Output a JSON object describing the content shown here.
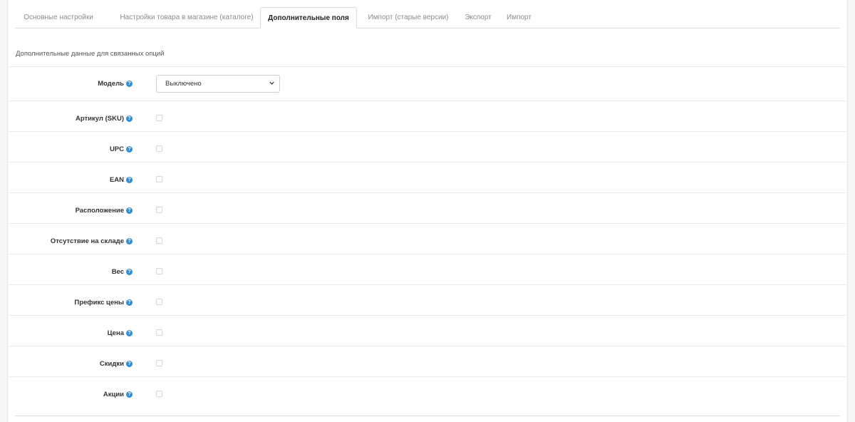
{
  "tabs": [
    {
      "label": "Основные настройки",
      "active": false
    },
    {
      "label": "Настройки товара в магазине (каталоге)",
      "active": false
    },
    {
      "label": "Дополнительные поля",
      "active": true
    },
    {
      "label": "Импорт (старые версии)",
      "active": false
    },
    {
      "label": "Экспорт",
      "active": false
    },
    {
      "label": "Импорт",
      "active": false
    }
  ],
  "section_title": "Дополнительные данные для связанных опций",
  "model": {
    "label": "Модель",
    "selected": "Выключено"
  },
  "fields": [
    {
      "label": "Артикул (SKU)",
      "checked": false
    },
    {
      "label": "UPC",
      "checked": false
    },
    {
      "label": "EAN",
      "checked": false
    },
    {
      "label": "Расположение",
      "checked": false
    },
    {
      "label": "Отсутствие на складе",
      "checked": false
    },
    {
      "label": "Вес",
      "checked": false
    },
    {
      "label": "Префикс цены",
      "checked": false
    },
    {
      "label": "Цена",
      "checked": false
    },
    {
      "label": "Скидки",
      "checked": false
    },
    {
      "label": "Акции",
      "checked": false
    }
  ],
  "help_icon": "question-circle-icon",
  "colors": {
    "help_icon": "#2f8ed4",
    "active_tab_text": "#222222",
    "inactive_tab_text": "#8c8c8c"
  }
}
